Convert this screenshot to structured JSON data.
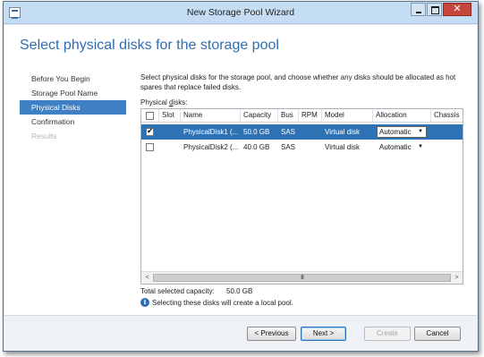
{
  "window": {
    "title": "New Storage Pool Wizard",
    "minimize_label": "–",
    "close_label": "✕"
  },
  "page": {
    "heading": "Select physical disks for the storage pool",
    "description": "Select physical disks for the storage pool, and choose whether any disks should be allocated as hot spares that replace failed disks.",
    "list_label_prefix": "Physical ",
    "list_label_accel": "d",
    "list_label_suffix": "isks:"
  },
  "sidebar": {
    "steps": [
      {
        "label": "Before You Begin",
        "state": "done"
      },
      {
        "label": "Storage Pool Name",
        "state": "done"
      },
      {
        "label": "Physical Disks",
        "state": "current"
      },
      {
        "label": "Confirmation",
        "state": "pending"
      },
      {
        "label": "Results",
        "state": "disabled"
      }
    ]
  },
  "grid": {
    "columns": [
      "Slot",
      "Name",
      "Capacity",
      "Bus",
      "RPM",
      "Model",
      "Allocation",
      "Chassis"
    ],
    "rows": [
      {
        "checked": true,
        "slot": "",
        "name": "PhysicalDisk1 (...",
        "capacity": "50.0 GB",
        "bus": "SAS",
        "rpm": "",
        "model": "Virtual disk",
        "allocation": "Automatic",
        "chassis": "",
        "selected": true
      },
      {
        "checked": false,
        "slot": "",
        "name": "PhysicalDisk2 (...",
        "capacity": "40.0 GB",
        "bus": "SAS",
        "rpm": "",
        "model": "Virtual disk",
        "allocation": "Automatic",
        "chassis": "",
        "selected": false
      }
    ],
    "scroll_left": "<",
    "scroll_right": ">",
    "scroll_grip": "III"
  },
  "summary": {
    "total_label": "Total selected capacity:",
    "total_value": "50.0 GB",
    "info_icon": "i",
    "info_text": "Selecting these disks will create a local pool."
  },
  "buttons": {
    "previous": "< Previous",
    "next": "Next >",
    "create": "Create",
    "cancel": "Cancel"
  },
  "icons": {
    "app": "storage-pool-icon",
    "info": "info-icon",
    "dropdown": "▼"
  }
}
